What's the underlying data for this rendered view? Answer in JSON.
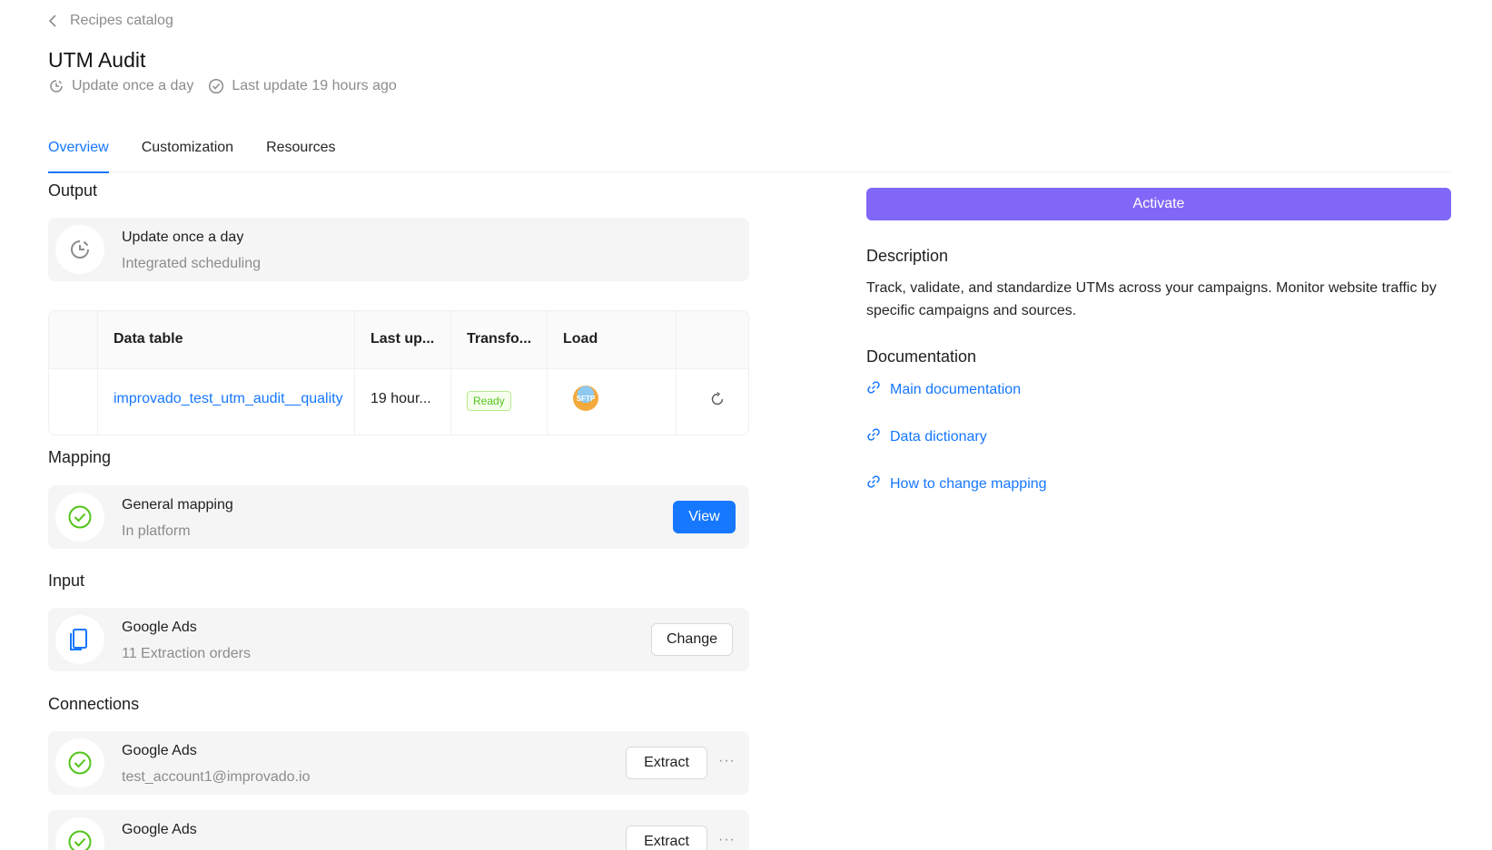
{
  "header": {
    "back_label": "Recipes catalog",
    "title": "UTM Audit",
    "schedule": "Update once a day",
    "last_update": "Last update 19 hours ago"
  },
  "tabs": [
    {
      "label": "Overview",
      "active": true
    },
    {
      "label": "Customization",
      "active": false
    },
    {
      "label": "Resources",
      "active": false
    }
  ],
  "output": {
    "title": "Output",
    "schedule_title": "Update once a day",
    "schedule_sub": "Integrated scheduling",
    "table": {
      "columns": [
        "Data table",
        "Last up...",
        "Transfo...",
        "Load"
      ],
      "rows": [
        {
          "data_table": "improvado_test_utm_audit__quality",
          "last_update": "19 hour...",
          "transform": "Ready",
          "load_icon": "sftp-icon",
          "load_label": "SFTP"
        }
      ]
    }
  },
  "mapping": {
    "title": "Mapping",
    "name": "General mapping",
    "sub": "In platform",
    "button": "View"
  },
  "input": {
    "title": "Input",
    "name": "Google Ads",
    "sub": "11 Extraction orders",
    "button": "Change"
  },
  "connections": {
    "title": "Connections",
    "items": [
      {
        "name": "Google Ads",
        "account": "test_account1@improvado.io",
        "button": "Extract",
        "more": "···"
      },
      {
        "name": "Google Ads",
        "account": "",
        "button": "Extract",
        "more": "···"
      }
    ]
  },
  "sidebar": {
    "activate": "Activate",
    "description_title": "Description",
    "description": "Track, validate, and standardize UTMs across your campaigns. Monitor website traffic by specific campaigns and sources.",
    "documentation_title": "Documentation",
    "links": [
      "Main documentation",
      "Data dictionary",
      "How to change mapping"
    ]
  },
  "colors": {
    "primary": "#1677ff",
    "activate": "#8167f7",
    "success": "#52c41a",
    "muted": "#8c8c8c"
  }
}
